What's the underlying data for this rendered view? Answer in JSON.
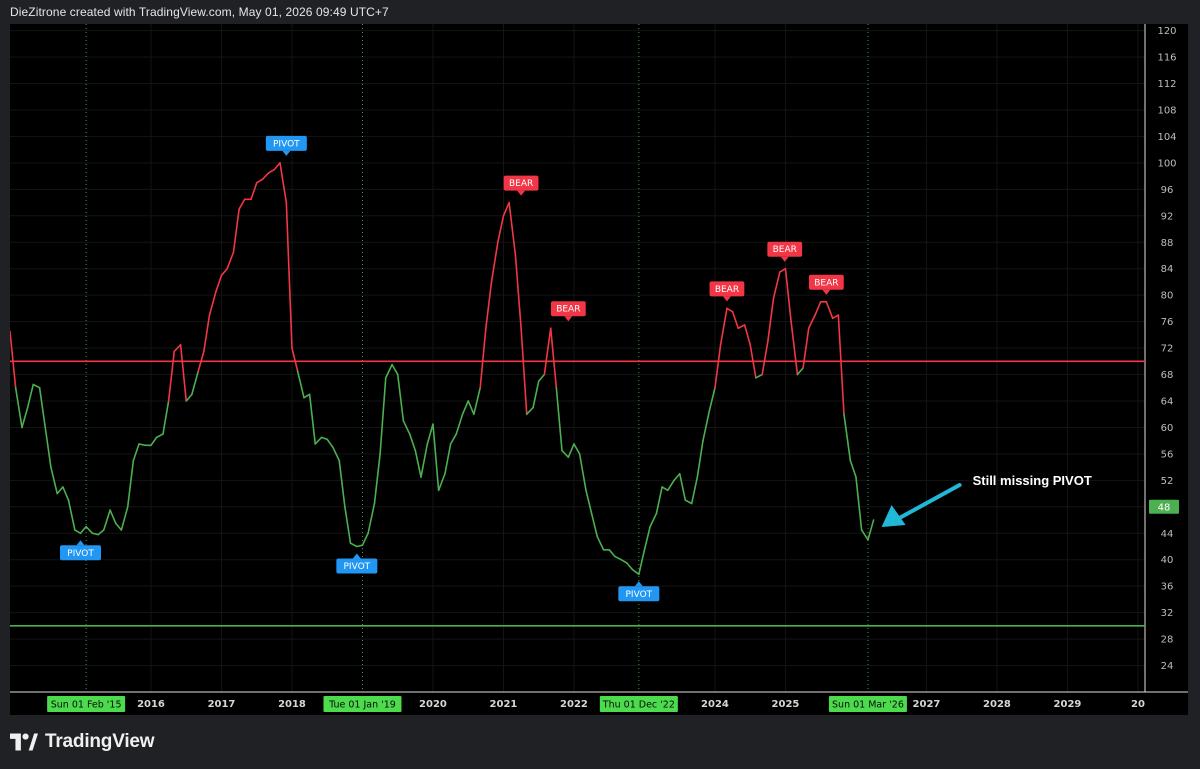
{
  "header": {
    "text": "DieZitrone created with TradingView.com, May 01, 2026 09:49 UTC+7"
  },
  "footer": {
    "brand": "TradingView"
  },
  "chart_data": {
    "type": "line",
    "title": "",
    "xlabel": "",
    "ylabel": "",
    "y_axis_position": "right",
    "y_range": [
      20,
      121
    ],
    "y_ticks": [
      24,
      28,
      32,
      36,
      40,
      44,
      48,
      52,
      56,
      60,
      64,
      68,
      72,
      76,
      80,
      84,
      88,
      92,
      96,
      100,
      104,
      108,
      112,
      116,
      120
    ],
    "x_range": [
      2014.0,
      2030.1
    ],
    "x_tick_labels": [
      {
        "x": 2016,
        "label": "2016"
      },
      {
        "x": 2017,
        "label": "2017"
      },
      {
        "x": 2018,
        "label": "2018"
      },
      {
        "x": 2020,
        "label": "2020"
      },
      {
        "x": 2021,
        "label": "2021"
      },
      {
        "x": 2022,
        "label": "2022"
      },
      {
        "x": 2024,
        "label": "2024"
      },
      {
        "x": 2025,
        "label": "2025"
      },
      {
        "x": 2027,
        "label": "2027"
      },
      {
        "x": 2028,
        "label": "2028"
      },
      {
        "x": 2029,
        "label": "2029"
      },
      {
        "x": 2030,
        "label": "20"
      }
    ],
    "highlighted_dates": [
      {
        "x": 2015.08,
        "label": "Sun 01 Feb '15"
      },
      {
        "x": 2019.0,
        "label": "Tue 01 Jan '19"
      },
      {
        "x": 2022.92,
        "label": "Thu 01 Dec '22"
      },
      {
        "x": 2026.17,
        "label": "Sun 01 Mar '26"
      }
    ],
    "threshold_lines": [
      {
        "y": 70,
        "color": "#f23645"
      },
      {
        "y": 30,
        "color": "#4caf50"
      }
    ],
    "colors": {
      "above_threshold": "#f23645",
      "below_threshold": "#4caf50",
      "pivot_tag": "#2196f3",
      "bear_tag": "#f23645",
      "arrow": "#21b8d8"
    },
    "series": [
      {
        "x": [
          2014.0,
          2014.08,
          2014.17,
          2014.25,
          2014.33,
          2014.42,
          2014.5,
          2014.58,
          2014.67,
          2014.75,
          2014.83,
          2014.92,
          2015.0,
          2015.08,
          2015.17,
          2015.25,
          2015.33,
          2015.42,
          2015.5,
          2015.58,
          2015.67,
          2015.75,
          2015.83,
          2015.92,
          2016.0,
          2016.08,
          2016.17,
          2016.25,
          2016.33,
          2016.42,
          2016.5,
          2016.58,
          2016.67,
          2016.75,
          2016.83,
          2016.92,
          2017.0,
          2017.08,
          2017.17,
          2017.25,
          2017.33,
          2017.42,
          2017.5,
          2017.58,
          2017.67,
          2017.75,
          2017.83,
          2017.92,
          2018.0,
          2018.08,
          2018.17,
          2018.25,
          2018.33,
          2018.42,
          2018.5,
          2018.58,
          2018.67,
          2018.75,
          2018.83,
          2018.92,
          2019.0,
          2019.08,
          2019.17,
          2019.25,
          2019.33,
          2019.42,
          2019.5,
          2019.58,
          2019.67,
          2019.75,
          2019.83,
          2019.92,
          2020.0,
          2020.08,
          2020.17,
          2020.25,
          2020.33,
          2020.42,
          2020.5,
          2020.58,
          2020.67,
          2020.75,
          2020.83,
          2020.92,
          2021.0,
          2021.08,
          2021.17,
          2021.25,
          2021.33,
          2021.42,
          2021.5,
          2021.58,
          2021.67,
          2021.75,
          2021.83,
          2021.92,
          2022.0,
          2022.08,
          2022.17,
          2022.25,
          2022.33,
          2022.42,
          2022.5,
          2022.58,
          2022.67,
          2022.75,
          2022.83,
          2022.92,
          2023.0,
          2023.08,
          2023.17,
          2023.25,
          2023.33,
          2023.42,
          2023.5,
          2023.58,
          2023.67,
          2023.75,
          2023.83,
          2023.92,
          2024.0,
          2024.08,
          2024.17,
          2024.25,
          2024.33,
          2024.42,
          2024.5,
          2024.58,
          2024.67,
          2024.75,
          2024.83,
          2024.92,
          2025.0,
          2025.08,
          2025.17,
          2025.25,
          2025.33,
          2025.42,
          2025.5,
          2025.58,
          2025.67,
          2025.75,
          2025.83,
          2025.92,
          2026.0,
          2026.08,
          2026.17,
          2026.25
        ],
        "y": [
          74.5,
          66,
          60,
          63,
          66.5,
          66,
          60,
          54,
          50,
          51,
          49,
          44.5,
          44,
          45,
          44,
          43.8,
          44.5,
          47.5,
          45.5,
          44.5,
          48,
          55,
          57.5,
          57.3,
          57.3,
          58.5,
          59,
          64,
          71.5,
          72.5,
          64,
          65,
          68.5,
          71.5,
          77,
          80.5,
          83,
          84,
          86.5,
          93,
          94.5,
          94.5,
          97,
          97.5,
          98.5,
          99,
          100,
          94,
          72,
          68.5,
          64.5,
          65,
          57.5,
          58.5,
          58.2,
          57,
          55,
          48,
          42.5,
          42,
          42.2,
          44,
          48.5,
          56,
          67.5,
          69.5,
          68,
          61,
          59,
          56.5,
          52.5,
          57.5,
          60.5,
          50.5,
          53,
          57.5,
          59,
          62,
          64,
          62,
          66,
          75,
          82,
          88,
          92,
          94,
          86,
          75,
          62,
          63,
          67,
          68,
          75,
          66,
          56.5,
          55.5,
          57.5,
          56,
          50.5,
          47,
          43.5,
          41.5,
          41.5,
          40.5,
          40,
          39.5,
          38.5,
          37.8,
          41.5,
          45,
          47,
          51,
          50.5,
          52,
          53,
          49,
          48.5,
          52.5,
          58,
          62.5,
          66,
          72.5,
          78,
          77.5,
          75,
          75.5,
          72.5,
          67.5,
          68,
          73,
          79.5,
          83.5,
          84,
          76,
          68,
          69,
          75,
          77,
          79,
          79,
          76.5,
          77,
          62,
          55,
          52.5,
          44.5,
          43,
          46
        ]
      }
    ],
    "annotations": [
      {
        "label": "PIVOT",
        "kind": "pivot",
        "x": 2015.0,
        "y": 44,
        "position": "below"
      },
      {
        "label": "PIVOT",
        "kind": "pivot",
        "x": 2017.92,
        "y": 100,
        "position": "above"
      },
      {
        "label": "PIVOT",
        "kind": "pivot",
        "x": 2018.92,
        "y": 42,
        "position": "below"
      },
      {
        "label": "PIVOT",
        "kind": "pivot",
        "x": 2022.92,
        "y": 37.8,
        "position": "below"
      },
      {
        "label": "BEAR",
        "kind": "bear",
        "x": 2021.25,
        "y": 94,
        "position": "above"
      },
      {
        "label": "BEAR",
        "kind": "bear",
        "x": 2021.92,
        "y": 75,
        "position": "above"
      },
      {
        "label": "BEAR",
        "kind": "bear",
        "x": 2024.17,
        "y": 78,
        "position": "above"
      },
      {
        "label": "BEAR",
        "kind": "bear",
        "x": 2024.99,
        "y": 84,
        "position": "above"
      },
      {
        "label": "BEAR",
        "kind": "bear",
        "x": 2025.58,
        "y": 79,
        "position": "above"
      }
    ],
    "last_value": {
      "y": 48,
      "label": "48"
    },
    "callout": {
      "text": "Still missing PIVOT",
      "arrow_to": {
        "x": 2026.25,
        "y": 46
      }
    }
  }
}
